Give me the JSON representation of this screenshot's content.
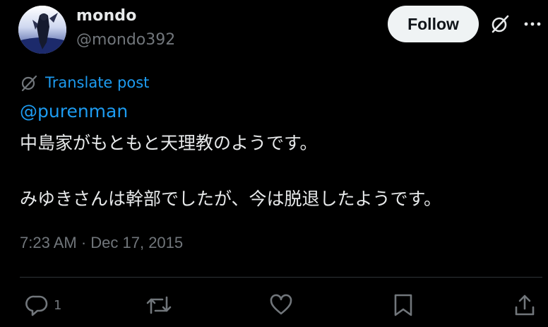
{
  "tweet": {
    "author": {
      "display_name": "mondo",
      "handle": "@mondo392"
    },
    "follow_label": "Follow",
    "translate_label": "Translate post",
    "mention": "@purenman",
    "body_lines": [
      "中島家がもともと天理教のようです。",
      "みゆきさんは幹部でしたが、今は脱退したようです。"
    ],
    "timestamp": "7:23 AM · Dec 17, 2015",
    "actions": {
      "reply_count": "1"
    }
  },
  "icons": {
    "grok": "grok-icon",
    "more": "more-icon",
    "translate": "globe-icon",
    "reply": "reply-icon",
    "repost": "repost-icon",
    "like": "heart-icon",
    "bookmark": "bookmark-icon",
    "share": "share-icon"
  },
  "colors": {
    "background": "#000000",
    "text": "#e7e9ea",
    "muted": "#71767b",
    "link": "#1d9bf0",
    "button_bg": "#eff3f4"
  }
}
